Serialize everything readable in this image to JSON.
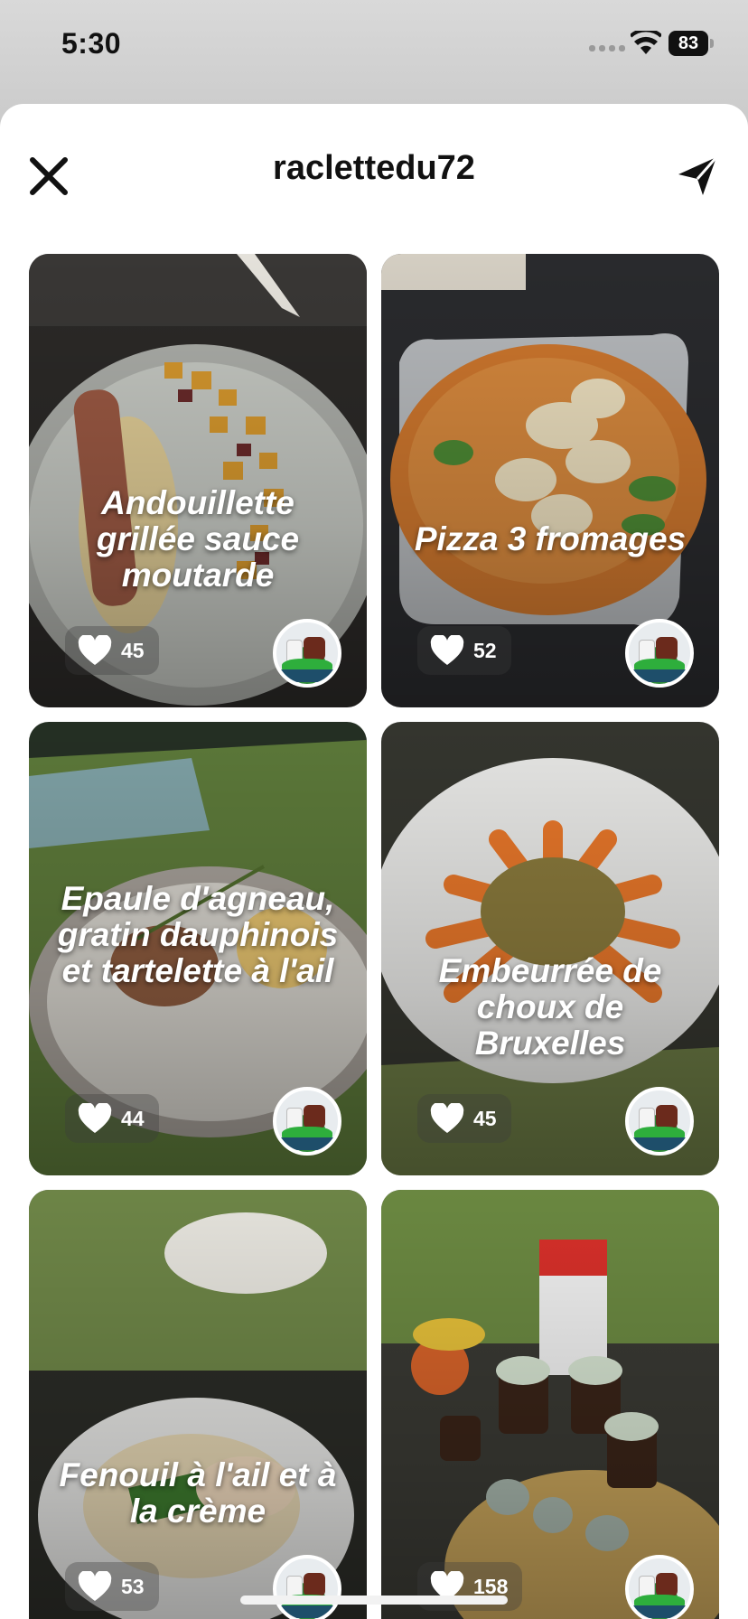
{
  "status_bar": {
    "time": "5:30",
    "battery": "83",
    "signal_icon": "cellular-signal-icon",
    "wifi_icon": "wifi-icon",
    "battery_icon": "battery-icon"
  },
  "header": {
    "title": "raclettedu72",
    "close_icon": "close-icon",
    "share_icon": "paper-plane-icon"
  },
  "cards": [
    {
      "title": "Andouillette grillée sauce moutarde",
      "likes": "45"
    },
    {
      "title": "Pizza 3 fromages",
      "likes": "52"
    },
    {
      "title": "Epaule d'agneau, gratin dauphinois et tartelette à l'ail",
      "likes": "44"
    },
    {
      "title": "Embeurrée de choux de Bruxelles",
      "likes": "45"
    },
    {
      "title": "Fenouil à l'ail et à la crème",
      "likes": "53"
    },
    {
      "title": "",
      "likes": "158"
    }
  ],
  "colors": {
    "text": "#111111",
    "sheet": "#ffffff",
    "overlay_text": "#ffffff"
  }
}
